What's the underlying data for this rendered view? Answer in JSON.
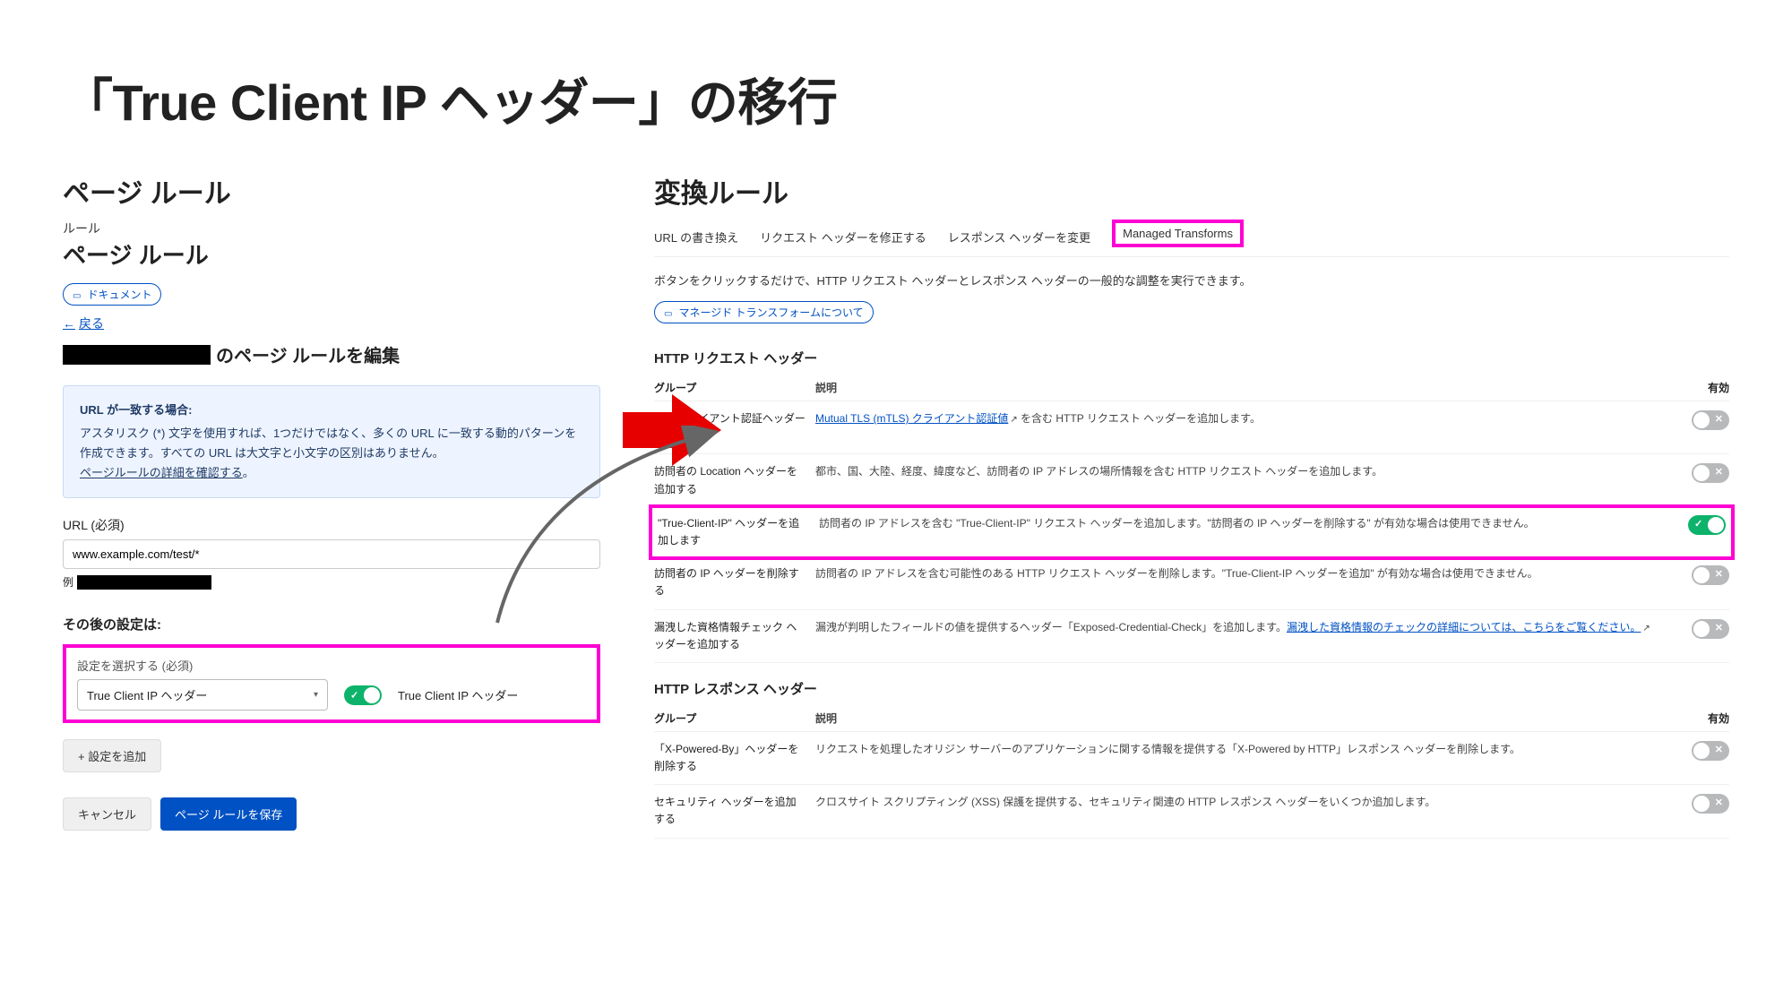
{
  "title": "「True Client IP ヘッダー」の移行",
  "left": {
    "section_title": "ページ ルール",
    "breadcrumb_label": "ルール",
    "page_title": "ページ ルール",
    "doc_badge": "ドキュメント",
    "back_link": "戻る",
    "edit_suffix": "のページ ルールを編集",
    "info": {
      "heading": "URL が一致する場合:",
      "body": "アスタリスク (*) 文字を使用すれば、1つだけではなく、多くの URL に一致する動的パターンを作成できます。すべての URL は大文字と小文字の区別はありません。",
      "more": "ページルールの詳細を確認する"
    },
    "url_label": "URL (必須)",
    "url_value": "www.example.com/test/*",
    "example_prefix": "例",
    "settings_header": "その後の設定は:",
    "select_label": "設定を選択する (必須)",
    "select_value": "True Client IP ヘッダー",
    "toggle_label": "True Client IP ヘッダー",
    "toggle_on": true,
    "add_setting_btn": "+ 設定を追加",
    "cancel_btn": "キャンセル",
    "save_btn": "ページ ルールを保存"
  },
  "right": {
    "section_title": "変換ルール",
    "tabs": [
      "URL の書き換え",
      "リクエスト ヘッダーを修正する",
      "レスポンス ヘッダーを変更",
      "Managed Transforms"
    ],
    "active_tab": 3,
    "desc": "ボタンをクリックするだけで、HTTP リクエスト ヘッダーとレスポンス ヘッダーの一般的な調整を実行できます。",
    "doc_badge": "マネージド トランスフォームについて",
    "groups": [
      {
        "heading": "HTTP リクエスト ヘッダー",
        "columns": [
          "グループ",
          "説明",
          "有効"
        ],
        "rows": [
          {
            "group": "TLS クライアント認証ヘッダーを追加する",
            "desc_prefix": "",
            "link": "Mutual TLS (mTLS) クライアント認証値",
            "desc_suffix": " を含む HTTP リクエスト ヘッダーを追加します。",
            "on": false,
            "highlight": false
          },
          {
            "group": "訪問者の Location ヘッダーを追加する",
            "desc": "都市、国、大陸、経度、緯度など、訪問者の IP アドレスの場所情報を含む HTTP リクエスト ヘッダーを追加します。",
            "on": false,
            "highlight": false
          },
          {
            "group": "\"True-Client-IP\" ヘッダーを追加します",
            "desc": "訪問者の IP アドレスを含む \"True-Client-IP\" リクエスト ヘッダーを追加します。\"訪問者の IP ヘッダーを削除する\" が有効な場合は使用できません。",
            "on": true,
            "highlight": true
          },
          {
            "group": "訪問者の IP ヘッダーを削除する",
            "desc": "訪問者の IP アドレスを含む可能性のある HTTP リクエスト ヘッダーを削除します。\"True-Client-IP ヘッダーを追加\" が有効な場合は使用できません。",
            "on": false,
            "highlight": false
          },
          {
            "group": "漏洩した資格情報チェック ヘッダーを追加する",
            "desc_prefix": "漏洩が判明したフィールドの値を提供するヘッダー「Exposed-Credential-Check」を追加します。",
            "link": "漏洩した資格情報のチェックの詳細については、こちらをご覧ください。",
            "on": false,
            "highlight": false
          }
        ]
      },
      {
        "heading": "HTTP レスポンス ヘッダー",
        "columns": [
          "グループ",
          "説明",
          "有効"
        ],
        "rows": [
          {
            "group": "「X-Powered-By」ヘッダーを削除する",
            "desc": "リクエストを処理したオリジン サーバーのアプリケーションに関する情報を提供する「X-Powered by HTTP」レスポンス ヘッダーを削除します。",
            "on": false,
            "highlight": false
          },
          {
            "group": "セキュリティ ヘッダーを追加する",
            "desc": "クロスサイト スクリプティング (XSS) 保護を提供する、セキュリティ関連の HTTP レスポンス ヘッダーをいくつか追加します。",
            "on": false,
            "highlight": false
          }
        ]
      }
    ]
  }
}
